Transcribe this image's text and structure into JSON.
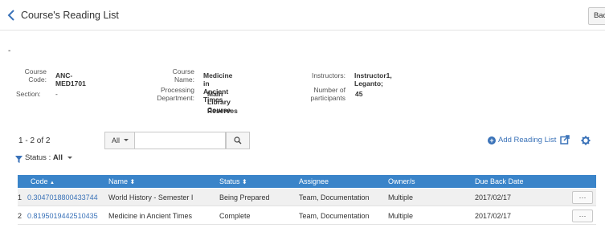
{
  "header": {
    "title": "Course's Reading List",
    "back_label": "Back"
  },
  "separator_text": "-",
  "course_info": {
    "course_code_label": "Course\nCode:",
    "course_code": "ANC-MED1701",
    "course_name_label": "Course\nName:",
    "course_name": "Medicine in Ancient Times",
    "instructors_label": "Instructors:",
    "instructors": "Instructor1, Leganto;",
    "section_label": "Section:",
    "section": "-",
    "processing_department_label": "Processing\nDepartment:",
    "processing_department_line1": "Main Library Course",
    "processing_department_line2": "Reserves",
    "participants_label": "Number of\nparticipants",
    "participants": "45"
  },
  "toolbar": {
    "count_text": "1 - 2 of 2",
    "scope_selected": "All",
    "search_value": "",
    "add_reading_list_label": "Add Reading List",
    "filter_label": "Status :",
    "filter_value": "All"
  },
  "table": {
    "columns": [
      "Code",
      "Name",
      "Status",
      "Assignee",
      "Owner/s",
      "Due Back Date"
    ],
    "code_sort_indicator": "▲",
    "sort_indicator": "⬍",
    "rows": [
      {
        "num": "1",
        "code": "0.3047018800433744",
        "name": "World History - Semester I",
        "status": "Being Prepared",
        "assignee": "Team, Documentation",
        "owners": "Multiple",
        "due": "2017/02/17",
        "action": "···"
      },
      {
        "num": "2",
        "code": "0.8195019442510435",
        "name": "Medicine in Ancient Times",
        "status": "Complete",
        "assignee": "Team, Documentation",
        "owners": "Multiple",
        "due": "2017/02/17",
        "action": "···"
      }
    ]
  },
  "colors": {
    "accent": "#3a72b8",
    "table_header": "#3a84c9"
  }
}
